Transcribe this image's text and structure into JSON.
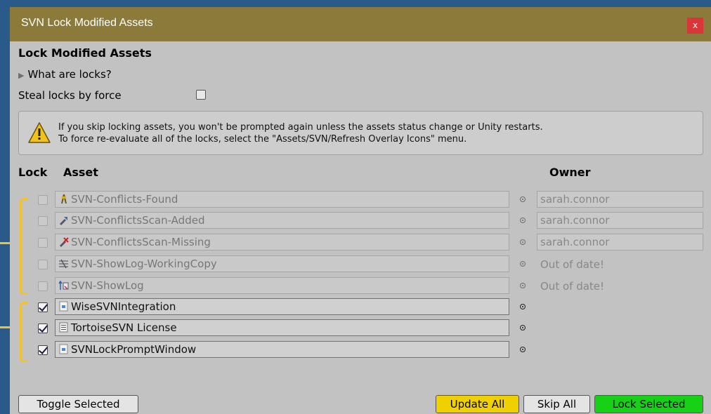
{
  "window": {
    "title": "SVN Lock Modified Assets",
    "close_label": "x"
  },
  "heading": "Lock Modified Assets",
  "foldout": {
    "label": "What are locks?"
  },
  "steal": {
    "label": "Steal locks by force",
    "checked": false
  },
  "help": {
    "line1": "If you skip locking assets, you won't be prompted again unless the assets status change or Unity restarts.",
    "line2": "To force re-evaluate all of the locks, select the \"Assets/SVN/Refresh Overlay Icons\" menu."
  },
  "columns": {
    "lock": "Lock",
    "asset": "Asset",
    "owner": "Owner"
  },
  "rows": [
    {
      "asset": "SVN-Conflicts-Found",
      "icon": "conflict-icon",
      "owner": "sarah.connor",
      "locked": false,
      "enabled": false
    },
    {
      "asset": "SVN-ConflictsScan-Added",
      "icon": "added-icon",
      "owner": "sarah.connor",
      "locked": false,
      "enabled": false
    },
    {
      "asset": "SVN-ConflictsScan-Missing",
      "icon": "missing-icon",
      "owner": "sarah.connor",
      "locked": false,
      "enabled": false
    },
    {
      "asset": "SVN-ShowLog-WorkingCopy",
      "icon": "log-icon",
      "status": "Out of date!",
      "locked": false,
      "enabled": false
    },
    {
      "asset": "SVN-ShowLog",
      "icon": "showlog-icon",
      "status": "Out of date!",
      "locked": false,
      "enabled": false
    },
    {
      "asset": "WiseSVNIntegration",
      "icon": "script-icon",
      "locked": true,
      "enabled": true
    },
    {
      "asset": "TortoiseSVN License",
      "icon": "text-file-icon",
      "locked": true,
      "enabled": true
    },
    {
      "asset": "SVNLockPromptWindow",
      "icon": "script-icon",
      "locked": true,
      "enabled": true
    }
  ],
  "buttons": {
    "toggle": "Toggle Selected",
    "update": "Update All",
    "skip": "Skip All",
    "lock": "Lock Selected"
  },
  "colors": {
    "titlebar": "#8c7a3a",
    "update": "#f0d000",
    "lock": "#17d117",
    "annotation": "#f0c22c",
    "close": "#d9363a"
  }
}
